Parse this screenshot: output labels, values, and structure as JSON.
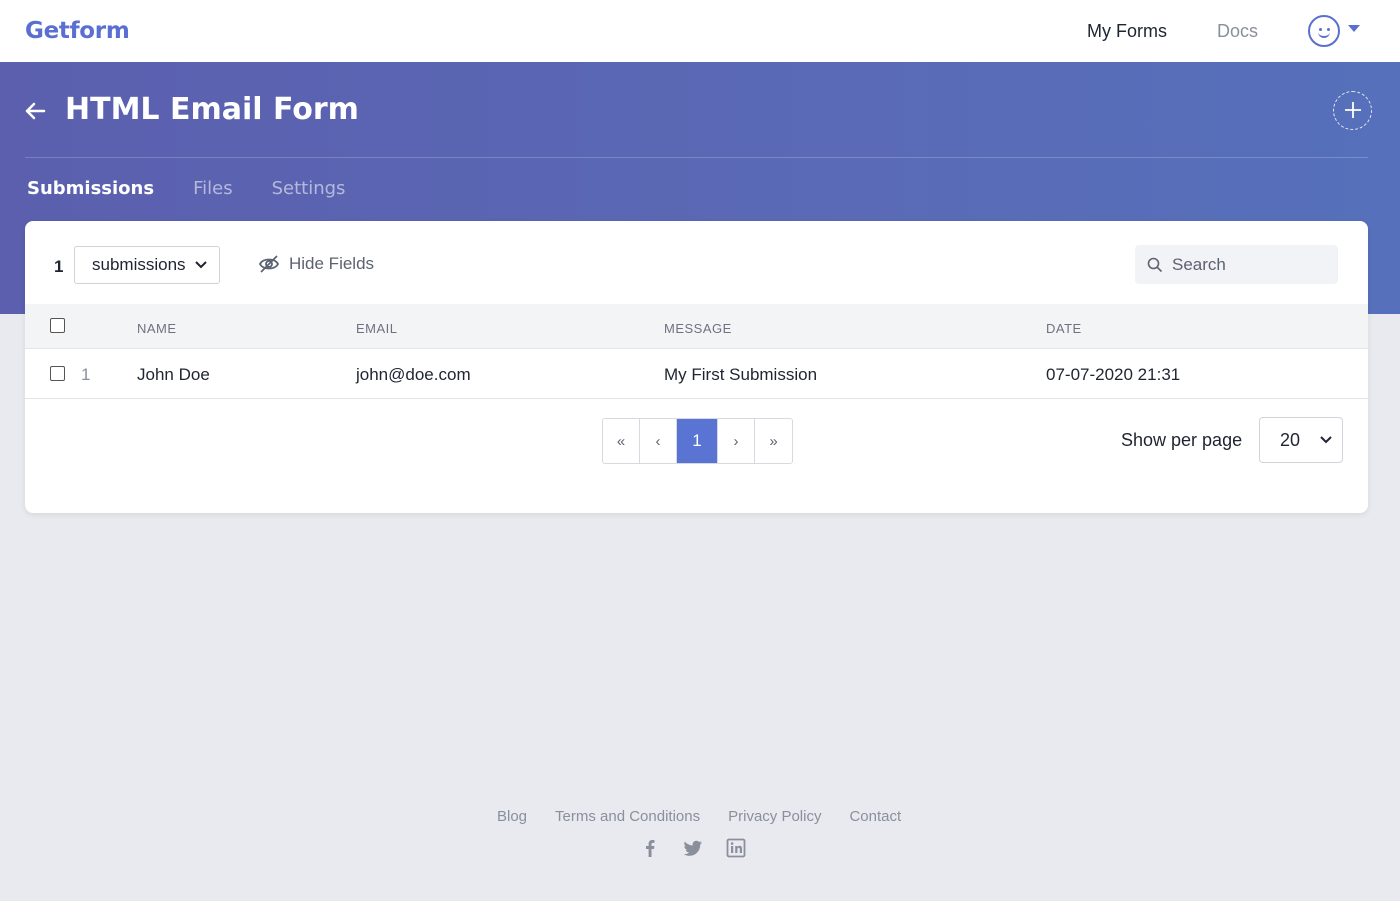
{
  "topnav": {
    "logo": "Getform",
    "links": [
      {
        "label": "My Forms"
      },
      {
        "label": "Docs"
      }
    ]
  },
  "header": {
    "title": "HTML Email Form",
    "tabs": [
      {
        "label": "Submissions",
        "active": true
      },
      {
        "label": "Files",
        "active": false
      },
      {
        "label": "Settings",
        "active": false
      }
    ]
  },
  "toolbar": {
    "count": "1",
    "view_select": "submissions",
    "hide_fields_label": "Hide Fields",
    "search_placeholder": "Search"
  },
  "table": {
    "columns": [
      "NAME",
      "EMAIL",
      "MESSAGE",
      "DATE"
    ],
    "rows": [
      {
        "index": "1",
        "name": "John Doe",
        "email": "john@doe.com",
        "message": "My First Submission",
        "date": "07-07-2020 21:31"
      }
    ]
  },
  "pagination": {
    "first": "«",
    "prev": "‹",
    "current": "1",
    "next": "›",
    "last": "»",
    "per_page_label": "Show per page",
    "per_page_value": "20"
  },
  "footer": {
    "links": [
      "Blog",
      "Terms and Conditions",
      "Privacy Policy",
      "Contact"
    ],
    "socials": [
      "facebook-icon",
      "twitter-icon",
      "linkedin-icon"
    ]
  },
  "colors": {
    "brand": "#5a6fd1",
    "header_band": "#5a66b3",
    "page_active": "#5a74d4",
    "background": "#e8eaef"
  }
}
